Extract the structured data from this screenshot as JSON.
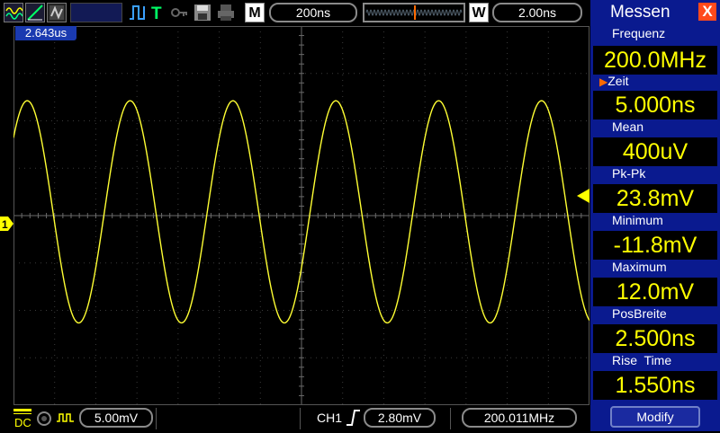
{
  "topbar": {
    "timebase": "200ns",
    "mode_letter": "M",
    "window_letter": "W",
    "window_value": "2.00ns",
    "icons": [
      "wave-icon",
      "ramp-icon",
      "waveform-display-icon",
      "pulse-icon",
      "trigger-t-icon",
      "key-icon",
      "save-icon",
      "print-icon"
    ]
  },
  "cursor_label": "2.643us",
  "ch1_marker": "1",
  "measure": {
    "title": "Messen",
    "close_label": "X",
    "items": [
      {
        "label": "Frequenz",
        "value": "200.0MHz"
      },
      {
        "label": "Zeit",
        "value": "5.000ns"
      },
      {
        "label": "Mean",
        "value": "400uV"
      },
      {
        "label": "Pk-Pk",
        "value": "23.8mV"
      },
      {
        "label": "Minimum",
        "value": "-11.8mV"
      },
      {
        "label": "Maximum",
        "value": "12.0mV"
      },
      {
        "label": "PosBreite",
        "value": "2.500ns"
      },
      {
        "label": "Rise  Time",
        "value": "1.550ns"
      }
    ],
    "modify_label": "Modify"
  },
  "bottombar": {
    "coupling": "DC",
    "volts_div": "5.00mV",
    "trigger_channel": "CH1",
    "trigger_level": "2.80mV",
    "frequency": "200.011MHz"
  },
  "colors": {
    "trace": "#ffff33",
    "panel": "#0a1a8f",
    "value_text": "#ffff00",
    "close": "#ff4a1c"
  }
}
